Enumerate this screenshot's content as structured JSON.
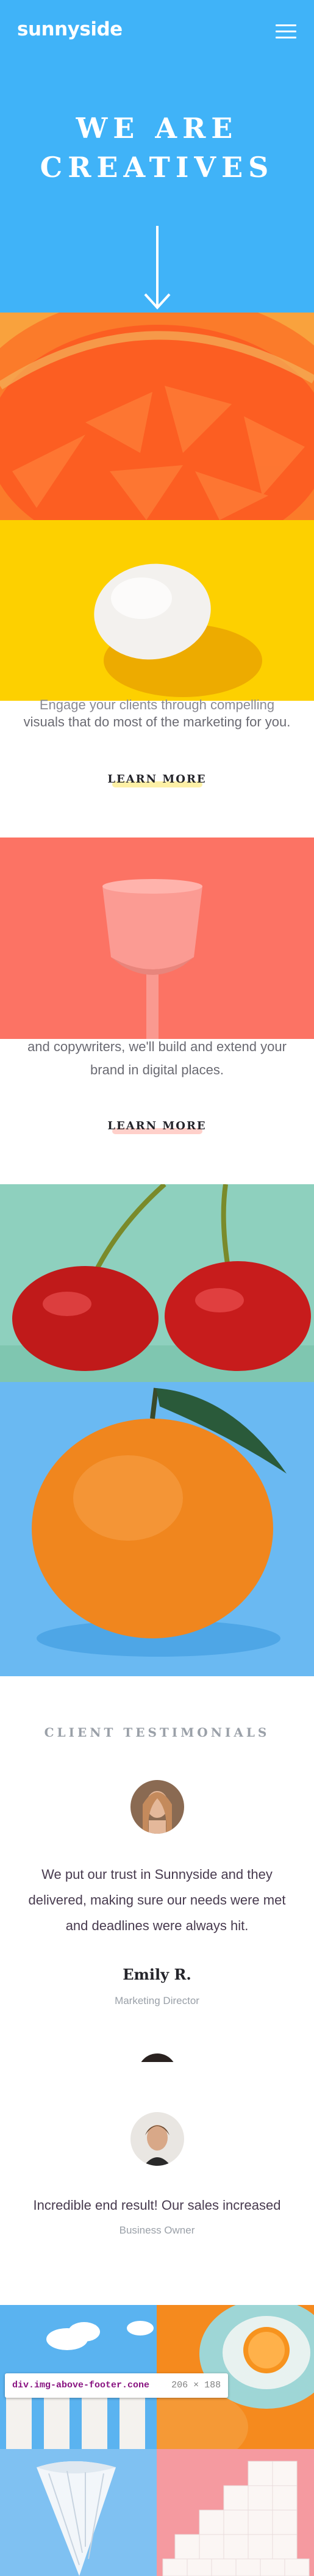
{
  "header": {
    "logo": "sunnyside",
    "menu_icon": "hamburger-menu-icon"
  },
  "hero": {
    "title_line1": "WE ARE",
    "title_line2": "CREATIVES",
    "arrow_icon": "arrow-down-icon",
    "background": "#40b3f8"
  },
  "sections": [
    {
      "image": "grapefruit-slice-image",
      "text_partial": "Engage your clients through compelling",
      "text": "visuals that do most of the marketing for you.",
      "cta": "LEARN MORE",
      "cta_accent": "#fad400"
    },
    {
      "image": "pink-cup-image",
      "text": "and copywriters, we'll build and extend your",
      "text2": "brand in digital places.",
      "cta": "LEARN MORE",
      "cta_accent": "#fe7867"
    }
  ],
  "images": {
    "egg": "egg-on-yellow-image",
    "cherries": "cherries-image",
    "orange": "orange-image"
  },
  "testimonials": {
    "heading": "CLIENT TESTIMONIALS",
    "items": [
      {
        "avatar": "emily-avatar",
        "quote": "We put our trust in Sunnyside and they delivered, making sure our needs were met and deadlines were always hit.",
        "name": "Emily R.",
        "role": "Marketing Director"
      },
      {
        "avatar": "business-owner-avatar",
        "quote": "Incredible end result! Our sales increased",
        "name": "",
        "role": "Business Owner"
      }
    ]
  },
  "devtools_tooltip": {
    "selector": "div.img-above-footer.cone",
    "size": "206 × 188"
  }
}
